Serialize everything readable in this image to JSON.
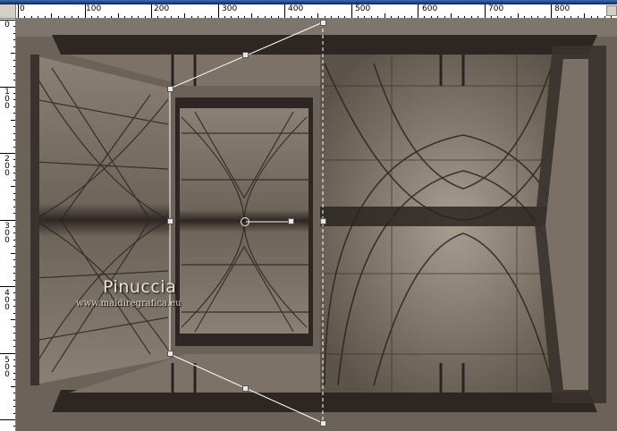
{
  "rulers": {
    "horizontal_labels": [
      "0",
      "100",
      "200",
      "300",
      "400",
      "500",
      "600",
      "700",
      "800"
    ],
    "vertical_labels": [
      "0",
      "100",
      "200",
      "300",
      "400",
      "500"
    ]
  },
  "watermark": {
    "name": "Pinuccia",
    "url": "www.maidiregrafica.eu"
  },
  "colors": {
    "background": "#4a423b",
    "panel_light": "#8a8074",
    "panel_dark": "#2e2622",
    "ruler": "#ffffff",
    "chrome": "#d4d0c8"
  }
}
